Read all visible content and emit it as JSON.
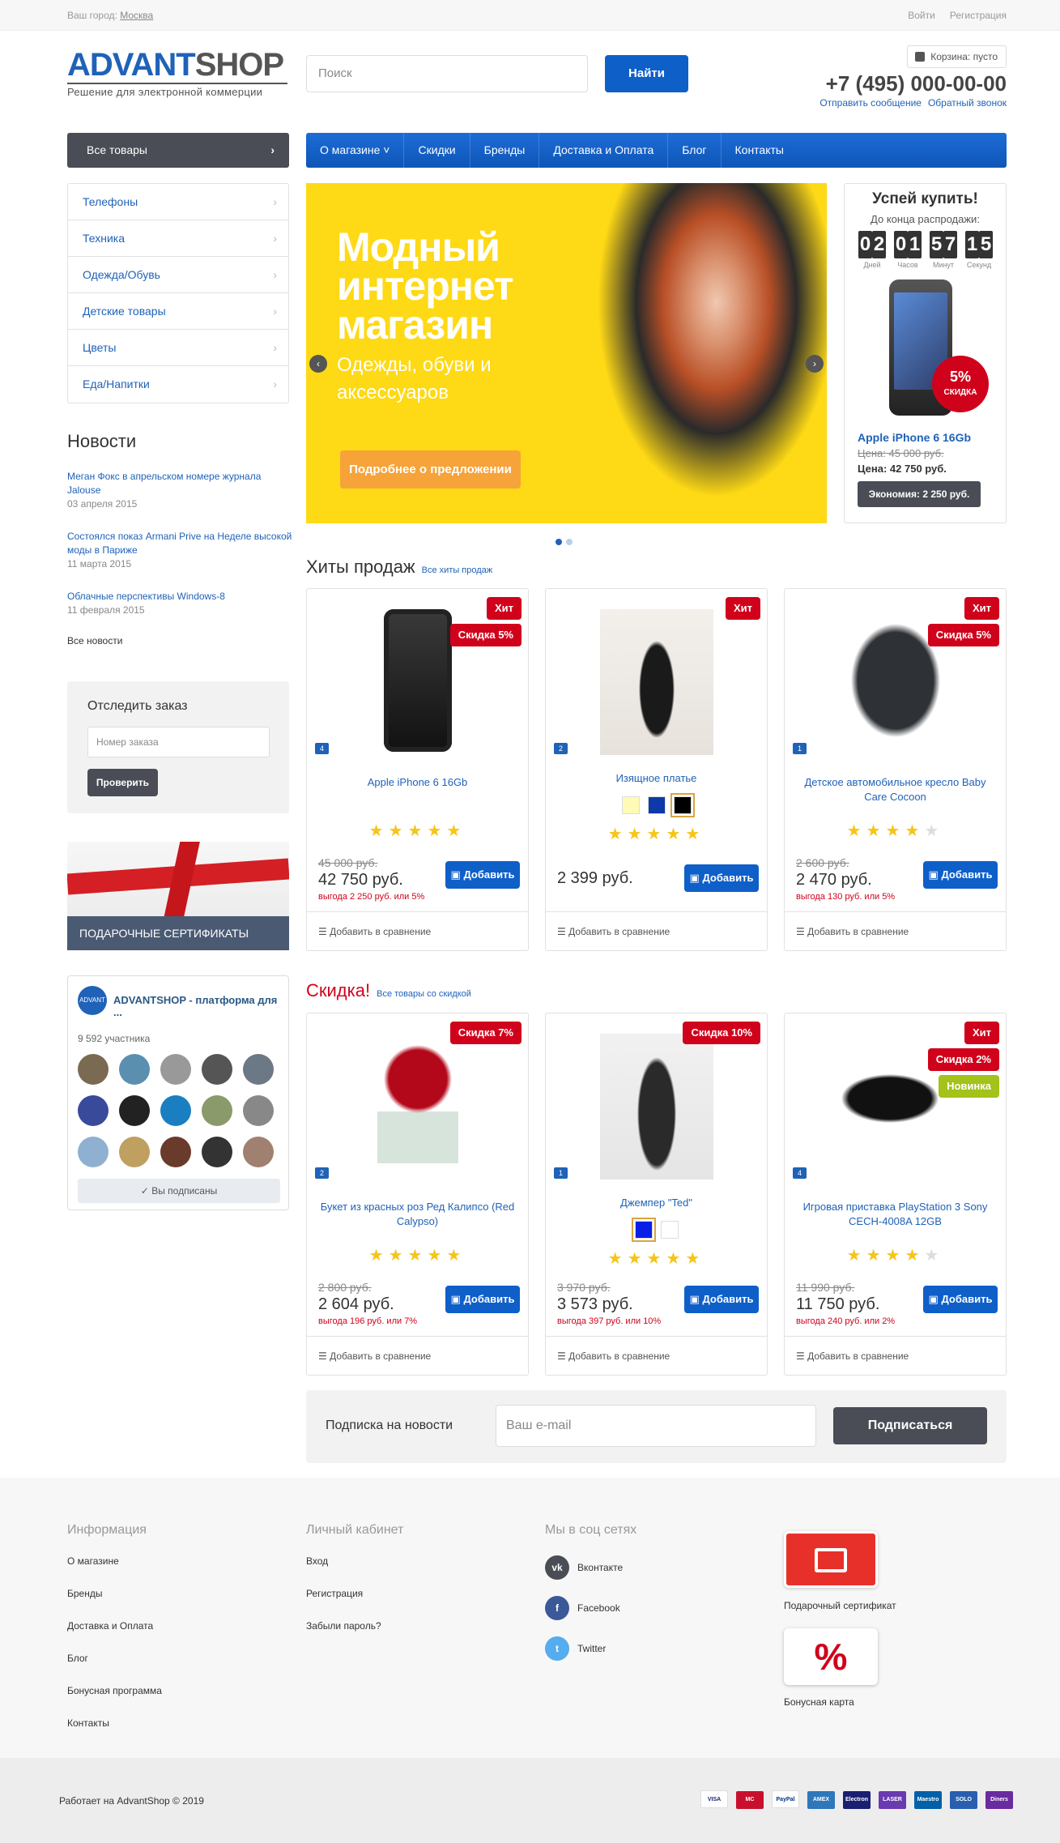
{
  "topbar": {
    "city_label": "Ваш город:",
    "city": "Москва",
    "login": "Войти",
    "register": "Регистрация"
  },
  "logo": {
    "part1": "ADVANT",
    "part2": "SHOP",
    "tagline": "Решение для электронной коммерции"
  },
  "search": {
    "placeholder": "Поиск",
    "button": "Найти"
  },
  "header": {
    "cart": "Корзина: пусто",
    "phone": "+7 (495) 000-00-00",
    "send_message": "Отправить сообщение",
    "callback": "Обратный звонок"
  },
  "nav": {
    "all_goods": "Все товары",
    "items": [
      "О магазине",
      "Скидки",
      "Бренды",
      "Доставка и Оплата",
      "Блог",
      "Контакты"
    ]
  },
  "categories": [
    "Телефоны",
    "Техника",
    "Одежда/Обувь",
    "Детские товары",
    "Цветы",
    "Еда/Напитки"
  ],
  "news": {
    "heading": "Новости",
    "items": [
      {
        "title": "Меган Фокс в апрельском номере журнала Jalouse",
        "date": "03 апреля 2015"
      },
      {
        "title": "Состоялся показ Armani Prive на Неделе высокой моды в Париже",
        "date": "11 марта 2015"
      },
      {
        "title": "Облачные перспективы Windows-8",
        "date": "11 февраля 2015"
      }
    ],
    "all": "Все новости"
  },
  "track": {
    "heading": "Отследить заказ",
    "placeholder": "Номер заказа",
    "button": "Проверить"
  },
  "gift_banner": "ПОДАРОЧНЫЕ СЕРТИФИКАТЫ",
  "vk": {
    "logo": "ADVANT SHOP",
    "name": "ADVANTSHOP - платформа для ...",
    "members": "9 592 участника",
    "subscribed": "Вы подписаны"
  },
  "banner": {
    "line1": "Модный",
    "line2": "интернет",
    "line3": "магазин",
    "sub1": "Одежды, обуви и",
    "sub2": "аксессуаров",
    "button": "Подробнее о предложении",
    "prev": "‹",
    "next": "›"
  },
  "deal": {
    "heading": "Успей купить!",
    "subheading": "До конца распродажи:",
    "timer": [
      {
        "digits": [
          "0",
          "2"
        ],
        "label": "Дней"
      },
      {
        "digits": [
          "0",
          "1"
        ],
        "label": "Часов"
      },
      {
        "digits": [
          "5",
          "7"
        ],
        "label": "Минут"
      },
      {
        "digits": [
          "1",
          "5"
        ],
        "label": "Секунд"
      }
    ],
    "discount": "5%",
    "discount_label": "СКИДКА",
    "name": "Apple iPhone 6 16Gb",
    "old_price": "Цена: 45 000 руб.",
    "price": "Цена: 42 750 руб.",
    "economy": "Экономия: 2 250 руб."
  },
  "hits": {
    "heading": "Хиты продаж",
    "link": "Все хиты продаж"
  },
  "sale": {
    "heading": "Скидка!",
    "link": "Все товары со скидкой"
  },
  "labels": {
    "add": "Добавить",
    "compare": "Добавить в сравнение"
  },
  "colors": {
    "accent": "#1f62b8",
    "button": "#0f5fc9",
    "badge_red": "#d0021b",
    "badge_green": "#a3c21a",
    "dark": "#4a4d55"
  },
  "products_hits": [
    {
      "name": "Apple iPhone 6 16Gb",
      "qty": "4",
      "badges": [
        "Хит",
        "Скидка 5%"
      ],
      "rating": 5,
      "old": "45 000 руб.",
      "price": "42 750 руб.",
      "save": "выгода 2 250 руб. или 5%",
      "colors": []
    },
    {
      "name": "Изящное платье",
      "qty": "2",
      "badges": [
        "Хит"
      ],
      "rating": 5,
      "old": "",
      "price": "2 399 руб.",
      "save": "",
      "colors": [
        "#fffbb5",
        "#0d3aa8",
        "#000000"
      ]
    },
    {
      "name": "Детское автомобильное кресло Baby Care Cocoon",
      "qty": "1",
      "badges": [
        "Хит",
        "Скидка 5%"
      ],
      "rating": 4,
      "old": "2 600 руб.",
      "price": "2 470 руб.",
      "save": "выгода 130 руб. или 5%",
      "colors": []
    }
  ],
  "products_sale": [
    {
      "name": "Букет из красных роз Ред Калипсо (Red Calypso)",
      "qty": "2",
      "badges": [
        "Скидка 7%"
      ],
      "rating": 5,
      "old": "2 800 руб.",
      "price": "2 604 руб.",
      "save": "выгода 196 руб. или 7%",
      "colors": []
    },
    {
      "name": "Джемпер \"Ted\"",
      "qty": "1",
      "badges": [
        "Скидка 10%"
      ],
      "rating": 5,
      "old": "3 970 руб.",
      "price": "3 573 руб.",
      "save": "выгода 397 руб. или 10%",
      "colors": [
        "#0a1fe6",
        "#ffffff"
      ]
    },
    {
      "name": "Игровая приставка PlayStation 3 Sony CECH-4008A 12GB",
      "qty": "4",
      "badges": [
        "Хит",
        "Скидка 2%",
        "Новинка"
      ],
      "rating": 4,
      "old": "11 990 руб.",
      "price": "11 750 руб.",
      "save": "выгода 240 руб. или 2%",
      "colors": []
    }
  ],
  "subscribe": {
    "label": "Подписка на новости",
    "placeholder": "Ваш e-mail",
    "button": "Подписаться"
  },
  "footer": {
    "info": {
      "heading": "Информация",
      "items": [
        "О магазине",
        "Бренды",
        "Доставка и Оплата",
        "Блог",
        "Бонусная программа",
        "Контакты"
      ]
    },
    "account": {
      "heading": "Личный кабинет",
      "items": [
        "Вход",
        "Регистрация",
        "Забыли пароль?"
      ]
    },
    "social": {
      "heading": "Мы в соц сетях",
      "items": [
        {
          "name": "Вконтакте",
          "icon": "vk",
          "color": "#4a4d55"
        },
        {
          "name": "Facebook",
          "icon": "f",
          "color": "#3b5998"
        },
        {
          "name": "Twitter",
          "icon": "t",
          "color": "#55acee"
        }
      ]
    },
    "gift_card": "Подарочный сертификат",
    "bonus_card": "Бонусная карта",
    "percent": "%",
    "copyright": "Работает на AdvantShop © 2019",
    "payments": [
      "VISA",
      "MC",
      "PayPal",
      "AMEX",
      "Electron",
      "LASER",
      "Maestro",
      "SOLO",
      "Diners"
    ]
  }
}
